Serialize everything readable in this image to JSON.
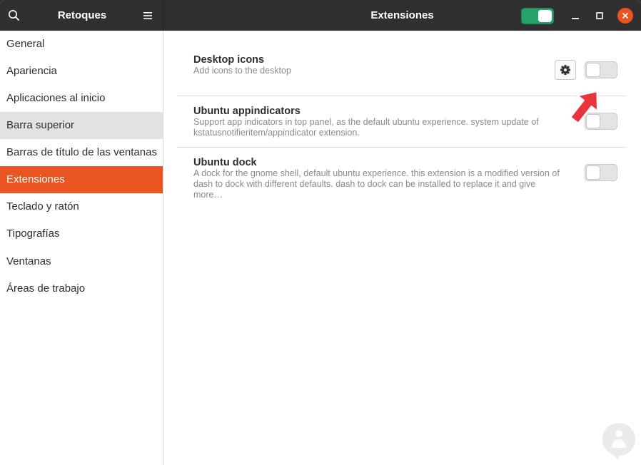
{
  "header": {
    "app_title": "Retoques",
    "page_title": "Extensiones",
    "master_switch_on": true
  },
  "sidebar": {
    "items": [
      {
        "label": "General"
      },
      {
        "label": "Apariencia"
      },
      {
        "label": "Aplicaciones al inicio"
      },
      {
        "label": "Barra superior"
      },
      {
        "label": "Barras de título de las ventanas"
      },
      {
        "label": "Extensiones"
      },
      {
        "label": "Teclado y ratón"
      },
      {
        "label": "Tipografías"
      },
      {
        "label": "Ventanas"
      },
      {
        "label": "Áreas de trabajo"
      }
    ],
    "selected": "Extensiones",
    "hovered": "Barra superior"
  },
  "extensions": [
    {
      "name": "Desktop icons",
      "description": "Add icons to the desktop",
      "enabled": false,
      "has_settings": true
    },
    {
      "name": "Ubuntu appindicators",
      "description": "Support app indicators in top panel, as the default ubuntu experience. system update of kstatusnotifieritem/appindicator extension.",
      "enabled": false,
      "has_settings": false
    },
    {
      "name": "Ubuntu dock",
      "description": "A dock for the gnome shell, default ubuntu experience. this extension is a modified version of dash to dock with different defaults. dash to dock can be installed to replace it and give more…",
      "enabled": false,
      "has_settings": false
    }
  ],
  "icons": {
    "search": "search-icon",
    "menu": "hamburger-menu-icon",
    "minimize": "minimize-icon",
    "maximize": "maximize-icon",
    "close": "close-icon",
    "gear": "gear-icon",
    "arrow": "red-arrow-annotation",
    "watermark": "watermark-logo"
  },
  "colors": {
    "accent": "#e95420",
    "switch_on": "#26a269",
    "headerbar": "#303030",
    "arrow": "#e8343a"
  }
}
